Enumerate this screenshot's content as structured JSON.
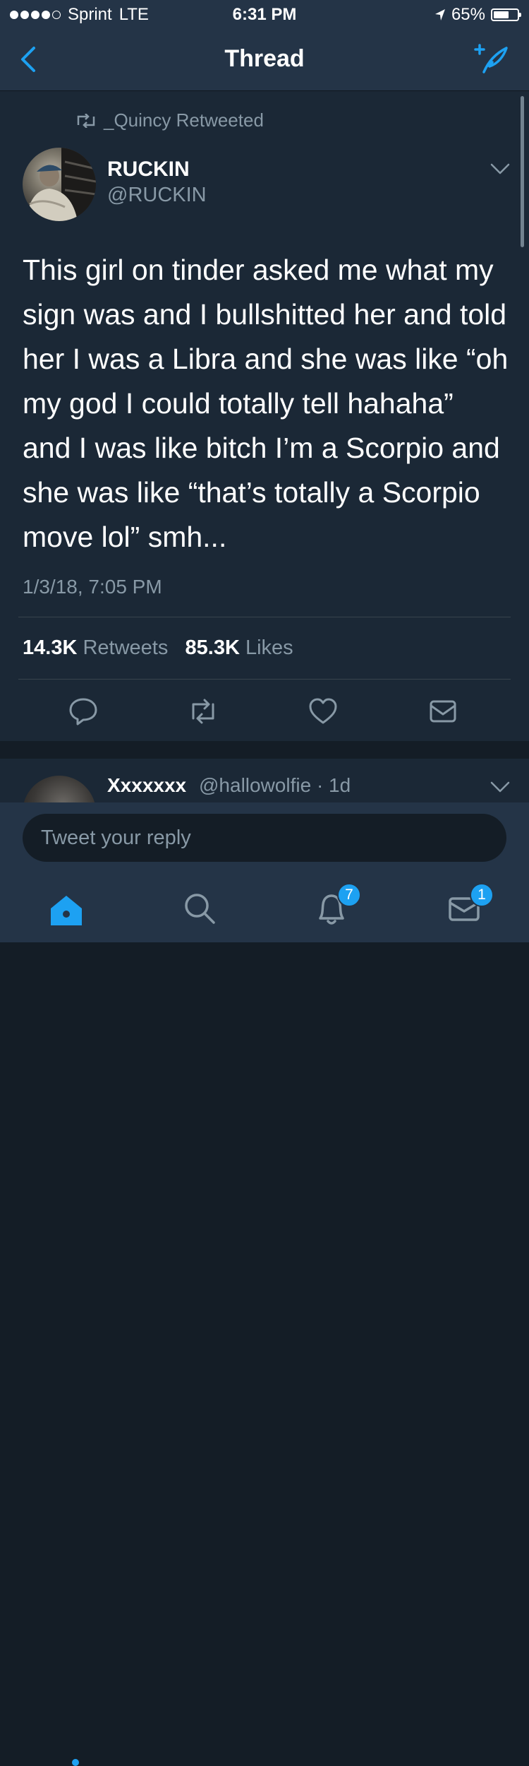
{
  "status_bar": {
    "carrier": "Sprint",
    "network": "LTE",
    "time": "6:31 PM",
    "battery_percent": "65%",
    "battery_level": 0.65,
    "signal_bars_filled": 4,
    "signal_bars_total": 5
  },
  "nav": {
    "title": "Thread",
    "back_icon": "chevron-left-icon",
    "compose_icon": "compose-tweet-icon"
  },
  "tweet": {
    "retweeted_by": "_Quincy Retweeted",
    "author_name": "RUCKIN",
    "author_handle": "@RUCKIN",
    "text": "This girl on tinder asked me what my sign was and I bullshitted her and told her I was a Libra and she was like “oh my god I could totally tell hahaha” and I was like bitch I’m a Scorpio and she was like “that’s totally a Scorpio move lol” smh...",
    "timestamp": "1/3/18, 7:05 PM",
    "retweets_count": "14.3K",
    "retweets_label": "Retweets",
    "likes_count": "85.3K",
    "likes_label": "Likes"
  },
  "reply_preview": {
    "name": "Xxxxxxx",
    "handle_time": "@hallowolfie · 1d"
  },
  "composer": {
    "placeholder": "Tweet your reply"
  },
  "tabbar": {
    "notifications_badge": "7",
    "messages_badge": "1"
  },
  "colors": {
    "background": "#141d26",
    "card": "#1b2836",
    "bars": "#243447",
    "accent": "#1da1f2",
    "secondary_text": "#8899a6"
  }
}
